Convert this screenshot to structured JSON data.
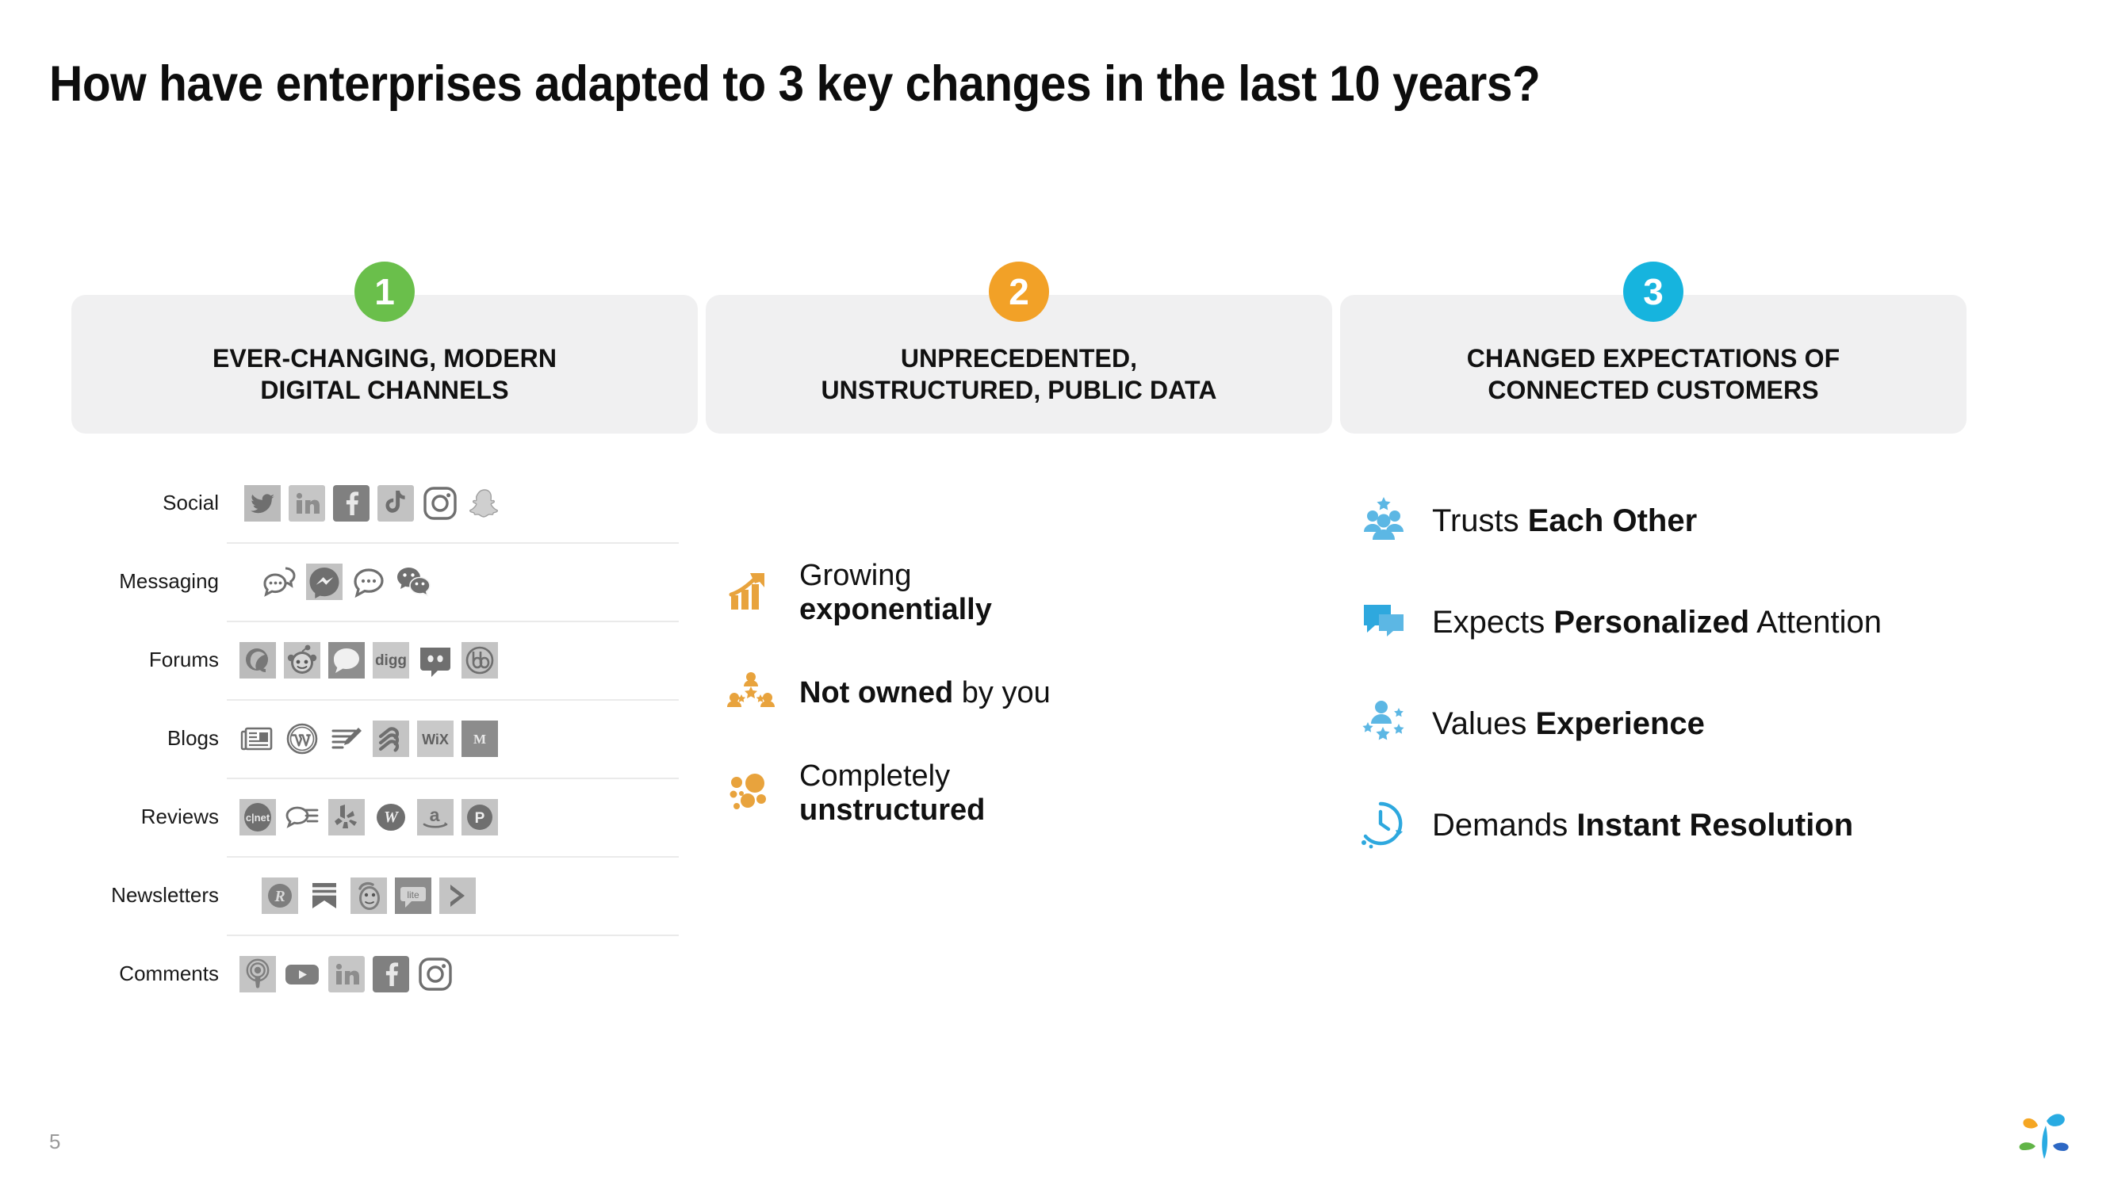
{
  "slide": {
    "title": "How have enterprises adapted to 3 key changes in the last 10 years?",
    "page_number": "5",
    "logo_name": "sprinklr-logo",
    "colors": {
      "green": "#6ABF4B",
      "orange": "#F2A127",
      "blue": "#16B4DE",
      "card_background": "#F0F0F1",
      "divider": "#EAEAEA",
      "icon_gray": "#7A7A7A",
      "icon_gray_light": "#B5B5B5",
      "page_number": "#9A9A9A"
    }
  },
  "columns": [
    {
      "badge": "1",
      "badge_color": "#6ABF4B",
      "title": "EVER-CHANGING, MODERN DIGITAL CHANNELS",
      "title_line1": "EVER-CHANGING, MODERN",
      "title_line2": "DIGITAL CHANNELS",
      "channels": [
        {
          "label": "Social",
          "icons": [
            "twitter-icon",
            "linkedin-icon",
            "facebook-icon",
            "tiktok-icon",
            "instagram-icon",
            "snapchat-icon"
          ]
        },
        {
          "label": "Messaging",
          "icons": [
            "chat-bubbles-icon",
            "facebook-messenger-icon",
            "sms-bubble-icon",
            "wechat-icon"
          ]
        },
        {
          "label": "Forums",
          "icons": [
            "quora-icon",
            "reddit-icon",
            "speech-bubble-icon",
            "digg-icon",
            "discord-icon",
            "bbpress-icon"
          ]
        },
        {
          "label": "Blogs",
          "icons": [
            "newspaper-icon",
            "wordpress-icon",
            "blog-writing-icon",
            "squarespace-icon",
            "wix-icon",
            "medium-icon"
          ]
        },
        {
          "label": "Reviews",
          "icons": [
            "cnet-icon",
            "review-bubble-icon",
            "yelp-icon",
            "wordofmouth-icon",
            "amazon-icon",
            "productreview-icon"
          ]
        },
        {
          "label": "Newsletters",
          "icons": [
            "revue-icon",
            "bookmark-icon",
            "mailchimp-icon",
            "lite-icon",
            "chevron-right-icon"
          ]
        },
        {
          "label": "Comments",
          "icons": [
            "podcast-icon",
            "youtube-icon",
            "linkedin-icon",
            "facebook-icon",
            "instagram-icon"
          ]
        }
      ]
    },
    {
      "badge": "2",
      "badge_color": "#F2A127",
      "title": "UNPRECEDENTED, UNSTRUCTURED, PUBLIC DATA",
      "title_line1": "UNPRECEDENTED,",
      "title_line2": "UNSTRUCTURED, PUBLIC DATA",
      "bullets": [
        {
          "icon": "growth-chart-icon",
          "text_plain_1": "Growing",
          "text_bold": "exponentially",
          "text_plain_2": ""
        },
        {
          "icon": "community-star-icon",
          "text_plain_1": "",
          "text_bold": "Not owned",
          "text_plain_2": " by you"
        },
        {
          "icon": "scattered-dots-icon",
          "text_plain_1": "Completely",
          "text_bold": "unstructured",
          "text_plain_2": ""
        }
      ]
    },
    {
      "badge": "3",
      "badge_color": "#16B4DE",
      "title": "CHANGED EXPECTATIONS OF CONNECTED CUSTOMERS",
      "title_line1": "CHANGED EXPECTATIONS OF",
      "title_line2": "CONNECTED CUSTOMERS",
      "bullets": [
        {
          "icon": "group-star-icon",
          "text_plain_1": "Trusts ",
          "text_bold": "Each Other",
          "text_plain_2": ""
        },
        {
          "icon": "chat-square-icon",
          "text_plain_1": "Expects ",
          "text_bold": "Personalized",
          "text_plain_2": " Attention"
        },
        {
          "icon": "person-stars-icon",
          "text_plain_1": "Values ",
          "text_bold": "Experience",
          "text_plain_2": ""
        },
        {
          "icon": "clock-arrow-icon",
          "text_plain_1": "Demands ",
          "text_bold": "Instant Resolution",
          "text_plain_2": ""
        }
      ]
    }
  ]
}
